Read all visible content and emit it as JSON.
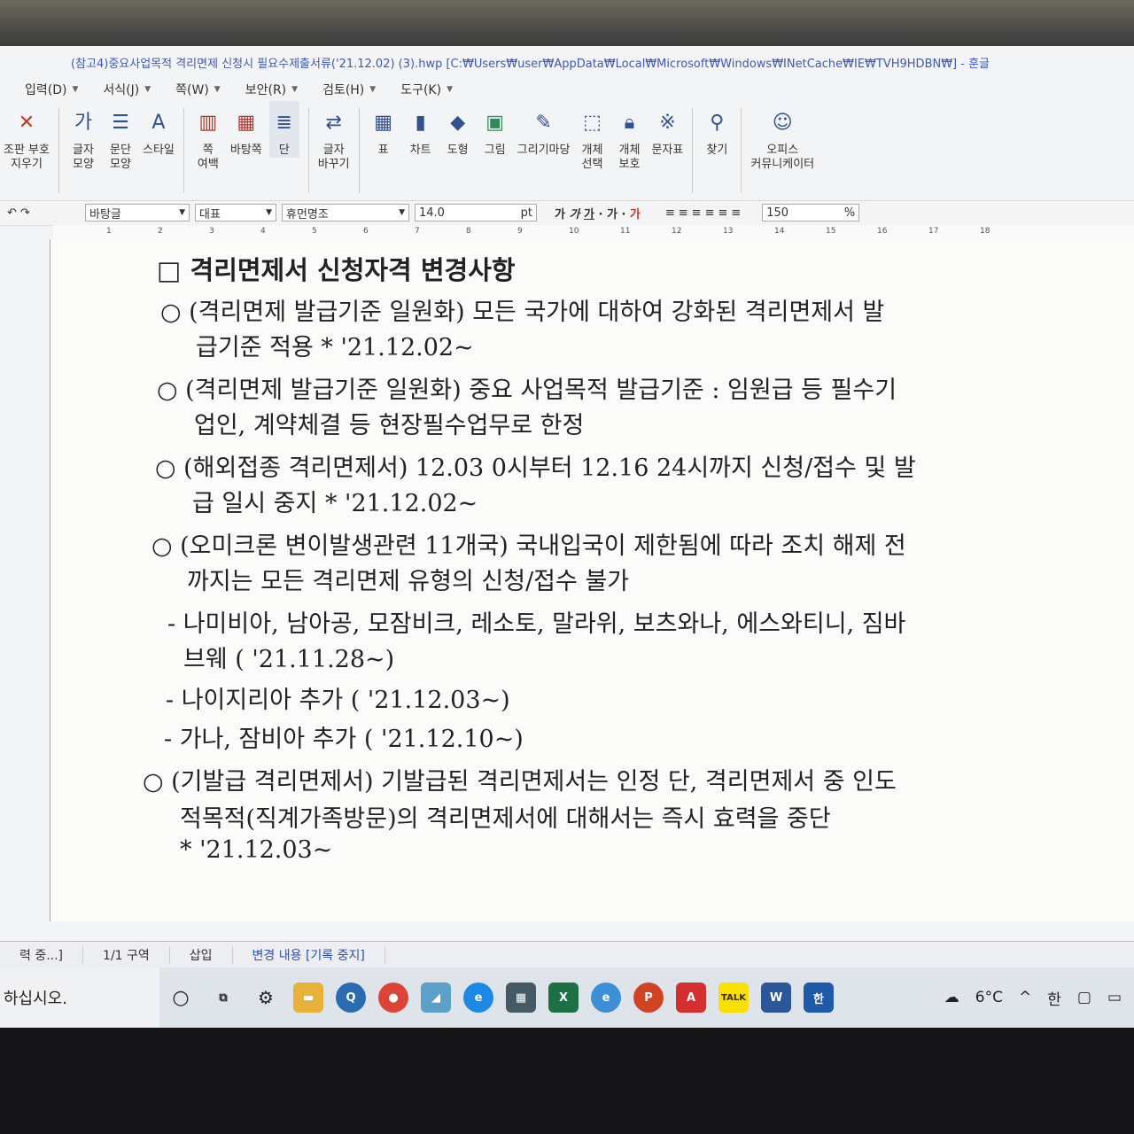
{
  "window": {
    "title": "(참고4)중요사업목적 격리면제 신청시 필요수제출서류('21.12.02) (3).hwp [C:₩Users₩user₩AppData₩Local₩Microsoft₩Windows₩INetCache₩IE₩TVH9HDBN₩] - 훈글"
  },
  "menu": [
    "입력(D)",
    "서식(J)",
    "쪽(W)",
    "보안(R)",
    "검토(H)",
    "도구(K)"
  ],
  "ribbon": {
    "clear_char": "조판 부호\n지우기",
    "char_shape": "글자\n모양",
    "para_shape": "문단\n모양",
    "style": "스타일",
    "page_margin": "쪽\n여백",
    "background": "바탕쪽",
    "column": "단",
    "replace": "글자\n바꾸기",
    "table": "표",
    "chart": "차트",
    "shape": "도형",
    "picture": "그림",
    "drawing": "그리기마당",
    "obj_select": "개체\n선택",
    "obj_protect": "개체\n보호",
    "char_map": "문자표",
    "find": "찾기",
    "office_comm": "오피스\n커뮤니케이터"
  },
  "format_bar": {
    "style": "바탕글",
    "lang": "대표",
    "font": "휴먼명조",
    "size": "14.0",
    "size_unit": "pt",
    "zoom": "150",
    "zoom_unit": "%"
  },
  "ruler": [
    "1",
    "2",
    "3",
    "4",
    "5",
    "6",
    "7",
    "8",
    "9",
    "10",
    "11",
    "12",
    "13",
    "14",
    "15",
    "16",
    "17",
    "18"
  ],
  "document": {
    "heading_box": "□",
    "heading": "격리면제서 신청자격 변경사항",
    "lines": [
      "○ (격리면제 발급기준 일원화) 모든 국가에 대하여 강화된 격리면제서 발",
      "급기준 적용 * '21.12.02~",
      "○ (격리면제 발급기준 일원화) 중요 사업목적 발급기준 : 임원급 등 필수기",
      "업인, 계약체결 등 현장필수업무로 한정",
      "○ (해외접종 격리면제서) 12.03 0시부터 12.16 24시까지 신청/접수 및 발",
      "급 일시 중지 * '21.12.02~",
      "○ (오미크론 변이발생관련 11개국) 국내입국이 제한됨에 따라 조치 해제 전",
      "까지는 모든 격리면제 유형의 신청/접수 불가",
      "- 나미비아, 남아공, 모잠비크, 레소토, 말라위, 보츠와나, 에스와티니, 짐바",
      "브웨 ( '21.11.28~)",
      "- 나이지리아 추가 ( '21.12.03~)",
      "- 가나, 잠비아 추가 ( '21.12.10~)",
      "○ (기발급 격리면제서) 기발급된 격리면제서는 인정 단, 격리면제서 중 인도",
      "적목적(직계가족방문)의 격리면제서에 대해서는 즉시 효력을 중단",
      "* '21.12.03~"
    ]
  },
  "status": {
    "mode": "력 중...]",
    "section": "1/1 구역",
    "insert": "삽입",
    "track": "변경 내용 [기록 중지]"
  },
  "taskbar": {
    "search": "하십시오.",
    "weather": "6°C",
    "ime": "한"
  }
}
